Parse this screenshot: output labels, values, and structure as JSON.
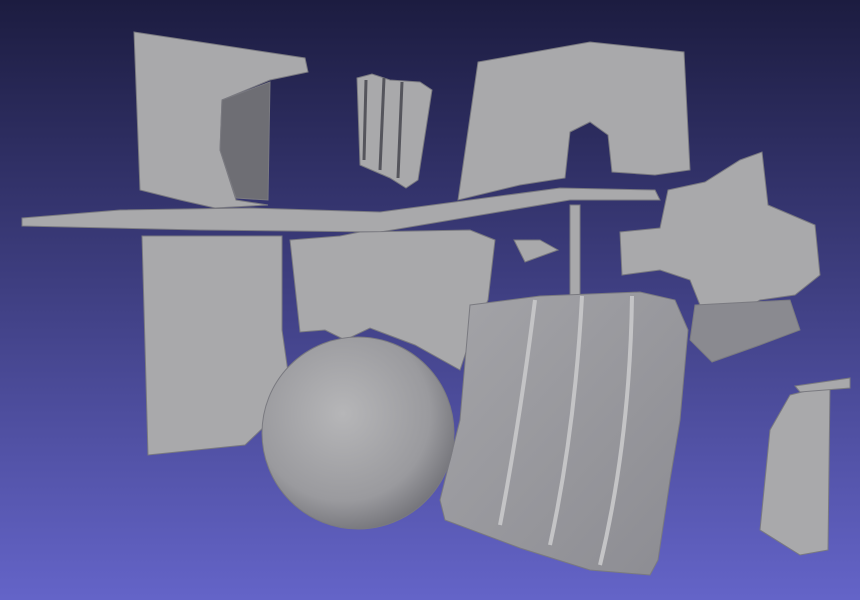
{
  "viewport": {
    "background_top": "#1c1c40",
    "background_bottom": "#6464c8",
    "mesh_color": "#a9a9ab",
    "mesh_shadow": "#6e6e74",
    "mesh_highlight": "#c4c4c6"
  }
}
